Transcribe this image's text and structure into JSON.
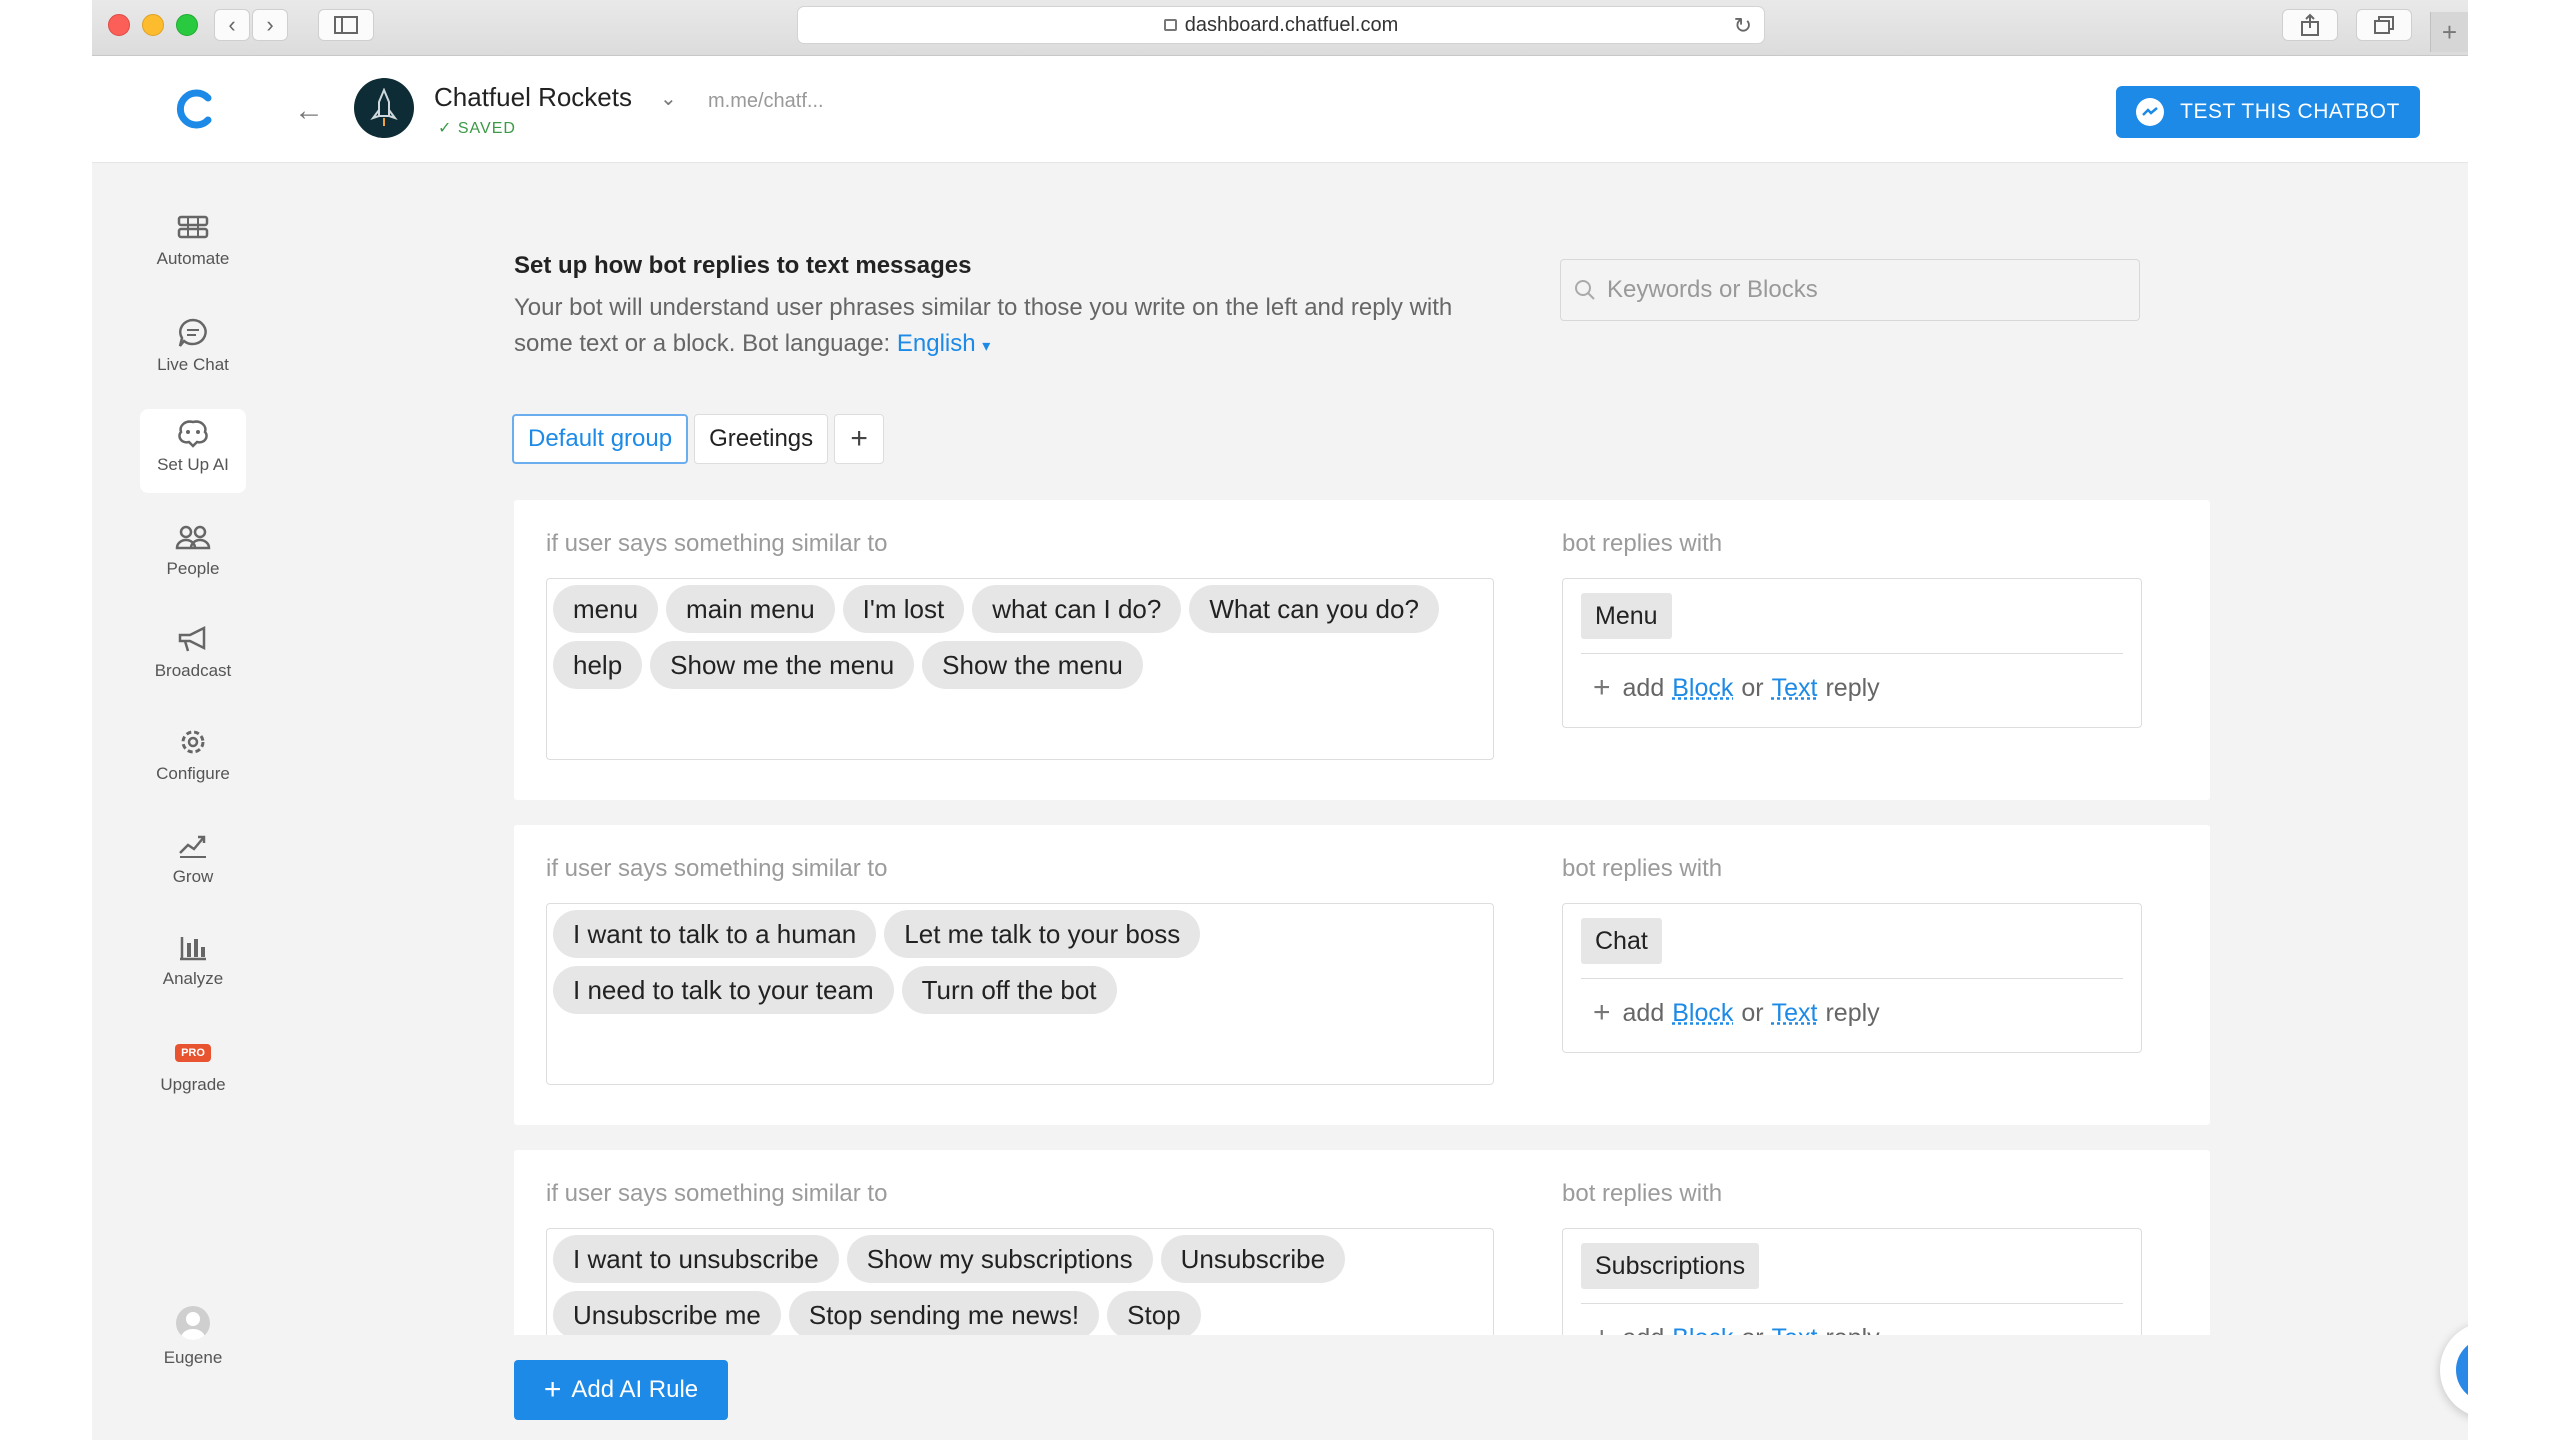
{
  "browser": {
    "url": "dashboard.chatfuel.com"
  },
  "header": {
    "bot_name": "Chatfuel Rockets",
    "saved": "SAVED",
    "link": "m.me/chatf...",
    "test_button": "TEST THIS CHATBOT"
  },
  "sidebar": {
    "items": [
      {
        "label": "Automate",
        "icon": "automate-icon"
      },
      {
        "label": "Live Chat",
        "icon": "chat-bubble-icon"
      },
      {
        "label": "Set Up AI",
        "icon": "brain-icon"
      },
      {
        "label": "People",
        "icon": "people-icon"
      },
      {
        "label": "Broadcast",
        "icon": "megaphone-icon"
      },
      {
        "label": "Configure",
        "icon": "gear-icon"
      },
      {
        "label": "Grow",
        "icon": "growth-icon"
      },
      {
        "label": "Analyze",
        "icon": "bar-chart-icon"
      },
      {
        "label": "Upgrade",
        "icon": "pro-badge",
        "badge": "PRO"
      }
    ],
    "active": "Set Up AI",
    "user": "Eugene"
  },
  "main": {
    "title": "Set up how bot replies to text messages",
    "description": "Your bot will understand user phrases similar to those you write on the left and reply with some text or a block. Bot language:",
    "language": "English",
    "search_placeholder": "Keywords or Blocks",
    "tabs": [
      "Default group",
      "Greetings"
    ],
    "if_label": "if user says something similar to",
    "reply_label": "bot replies with",
    "add_word": "add",
    "block_word": "Block",
    "or_word": "or",
    "text_word": "Text",
    "reply_word": "reply",
    "rules": [
      {
        "phrases": [
          "menu",
          "main menu",
          "I'm lost",
          "what can I do?",
          "What can you do?",
          "help",
          "Show me the menu",
          "Show the menu"
        ],
        "block": "Menu"
      },
      {
        "phrases": [
          "I want to talk to a human",
          "Let me talk to your boss",
          "I need to talk to your team",
          "Turn off the bot"
        ],
        "block": "Chat"
      },
      {
        "phrases": [
          "I want to unsubscribe",
          "Show my subscriptions",
          "Unsubscribe",
          "Unsubscribe me",
          "Stop sending me news!",
          "Stop"
        ],
        "block": "Subscriptions"
      }
    ],
    "add_rule_button": "Add AI Rule"
  },
  "colors": {
    "accent": "#1c8ae6",
    "saved_green": "#3a9a45",
    "pro_badge": "#e8542f"
  }
}
